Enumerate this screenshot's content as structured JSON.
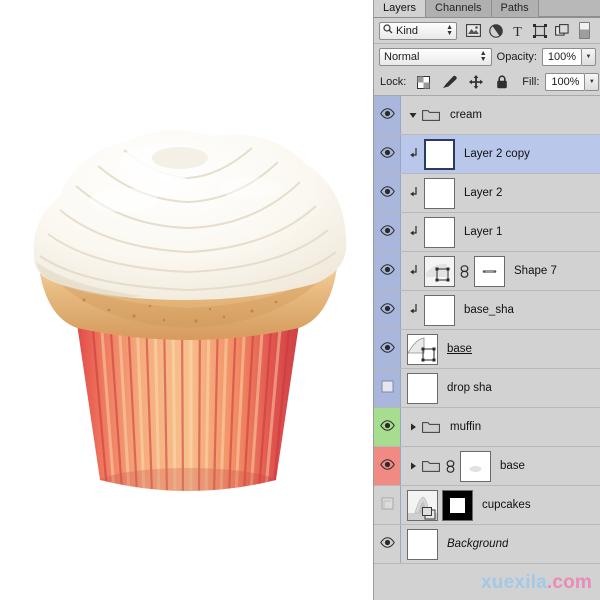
{
  "panel": {
    "title": "Layers",
    "tabs": [
      {
        "label": "Layers",
        "active": true
      },
      {
        "label": "Channels",
        "active": false
      },
      {
        "label": "Paths",
        "active": false
      }
    ],
    "filter": {
      "kind_label": "Kind",
      "search_icon": "magnifier-icon",
      "icons": [
        "pixel-layer-filter-icon",
        "adjustment-layer-filter-icon",
        "type-layer-filter-icon",
        "shape-layer-filter-icon",
        "smart-object-filter-icon",
        "filter-toggle-switch"
      ]
    },
    "blend": {
      "mode": "Normal",
      "opacity_label": "Opacity:",
      "opacity_value": "100%"
    },
    "lock": {
      "label": "Lock:",
      "icons": [
        "lock-transparent-pixels-icon",
        "lock-image-pixels-icon",
        "lock-position-icon",
        "lock-all-icon"
      ],
      "fill_label": "Fill:",
      "fill_value": "100%"
    }
  },
  "layers": [
    {
      "name": "cream",
      "type": "group",
      "visible": true,
      "selected": false,
      "expanded": true,
      "clipped": false,
      "eye_color": "blue",
      "indent": 0,
      "thumb": "none"
    },
    {
      "name": "Layer 2 copy",
      "type": "pixel",
      "visible": true,
      "selected": true,
      "clipped": true,
      "eye_color": "blue",
      "indent": 1,
      "thumb": "transparent"
    },
    {
      "name": "Layer 2",
      "type": "pixel",
      "visible": true,
      "selected": false,
      "clipped": true,
      "eye_color": "blue",
      "indent": 1,
      "thumb": "transparent"
    },
    {
      "name": "Layer 1",
      "type": "pixel",
      "visible": true,
      "selected": false,
      "clipped": true,
      "eye_color": "blue",
      "indent": 1,
      "thumb": "transparent"
    },
    {
      "name": "Shape 7",
      "type": "shape",
      "visible": true,
      "selected": false,
      "clipped": true,
      "eye_color": "blue",
      "indent": 1,
      "thumb": "shape",
      "linked": true,
      "vector_mask": true
    },
    {
      "name": "base_sha",
      "type": "pixel",
      "visible": true,
      "selected": false,
      "clipped": true,
      "eye_color": "blue",
      "indent": 1,
      "thumb": "transparent"
    },
    {
      "name": "base",
      "type": "shape",
      "visible": true,
      "selected": false,
      "clipped": false,
      "eye_color": "blue",
      "indent": 0,
      "thumb": "shape",
      "underlined": true
    },
    {
      "name": "drop sha",
      "type": "pixel",
      "visible": false,
      "selected": false,
      "clipped": false,
      "eye_color": "blue",
      "indent": 0,
      "thumb": "transparent"
    },
    {
      "name": "muffin",
      "type": "group",
      "visible": true,
      "selected": false,
      "expanded": false,
      "clipped": false,
      "eye_color": "green",
      "indent": 0,
      "thumb": "none"
    },
    {
      "name": "base",
      "type": "group",
      "visible": true,
      "selected": false,
      "expanded": false,
      "clipped": false,
      "eye_color": "red",
      "indent": 0,
      "thumb": "mask-white",
      "linked": true
    },
    {
      "name": "cupcakes",
      "type": "smart-object",
      "visible": false,
      "selected": false,
      "clipped": false,
      "eye_color": "grey",
      "indent": 0,
      "thumb": "smart-object",
      "layer_mask": "black-with-white-center"
    },
    {
      "name": "Background",
      "type": "background",
      "visible": true,
      "selected": false,
      "clipped": false,
      "eye_color": "grey",
      "indent": 0,
      "thumb": "white",
      "italic": true
    }
  ],
  "canvas": {
    "artwork": "cupcake-illustration",
    "description": "Cupcake with white swirled frosting, golden baked top and red-and-cream striped paper wrapper"
  },
  "watermark": {
    "part1": "xuexila",
    "part2": ".com",
    "color1": "#9ec9e8",
    "color2": "#ef84b4"
  }
}
